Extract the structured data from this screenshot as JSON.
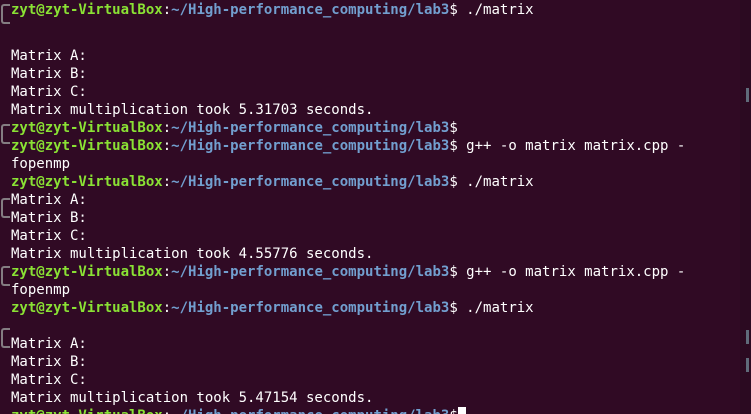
{
  "prompt": {
    "user_host": "zyt@zyt-VirtualBox",
    "separator": ":",
    "path": "~/High-performance_computing/lab3",
    "symbol": "$"
  },
  "lines": [
    {
      "type": "prompt",
      "command": " ./matrix"
    },
    {
      "type": "output",
      "text": ""
    },
    {
      "type": "output",
      "text": "Matrix A:"
    },
    {
      "type": "output",
      "text": "Matrix B:"
    },
    {
      "type": "output",
      "text": "Matrix C:"
    },
    {
      "type": "output",
      "text": "Matrix multiplication took 5.31703 seconds."
    },
    {
      "type": "prompt",
      "command": ""
    },
    {
      "type": "prompt",
      "command": " g++ -o matrix matrix.cpp -"
    },
    {
      "type": "output",
      "text": "fopenmp"
    },
    {
      "type": "prompt",
      "command": " ./matrix"
    },
    {
      "type": "output",
      "text": "Matrix A:"
    },
    {
      "type": "output",
      "text": "Matrix B:"
    },
    {
      "type": "output",
      "text": "Matrix C:"
    },
    {
      "type": "output",
      "text": "Matrix multiplication took 4.55776 seconds."
    },
    {
      "type": "prompt",
      "command": " g++ -o matrix matrix.cpp -"
    },
    {
      "type": "output",
      "text": "fopenmp"
    },
    {
      "type": "prompt",
      "command": " ./matrix"
    },
    {
      "type": "output",
      "text": ""
    },
    {
      "type": "output",
      "text": "Matrix A:"
    },
    {
      "type": "output",
      "text": "Matrix B:"
    },
    {
      "type": "output",
      "text": "Matrix C:"
    },
    {
      "type": "output",
      "text": "Matrix multiplication took 5.47154 seconds."
    },
    {
      "type": "prompt",
      "command": ""
    }
  ],
  "colors": {
    "background": "#300a24",
    "user_host": "#8ae234",
    "path": "#729fcf",
    "text": "#ffffff"
  }
}
